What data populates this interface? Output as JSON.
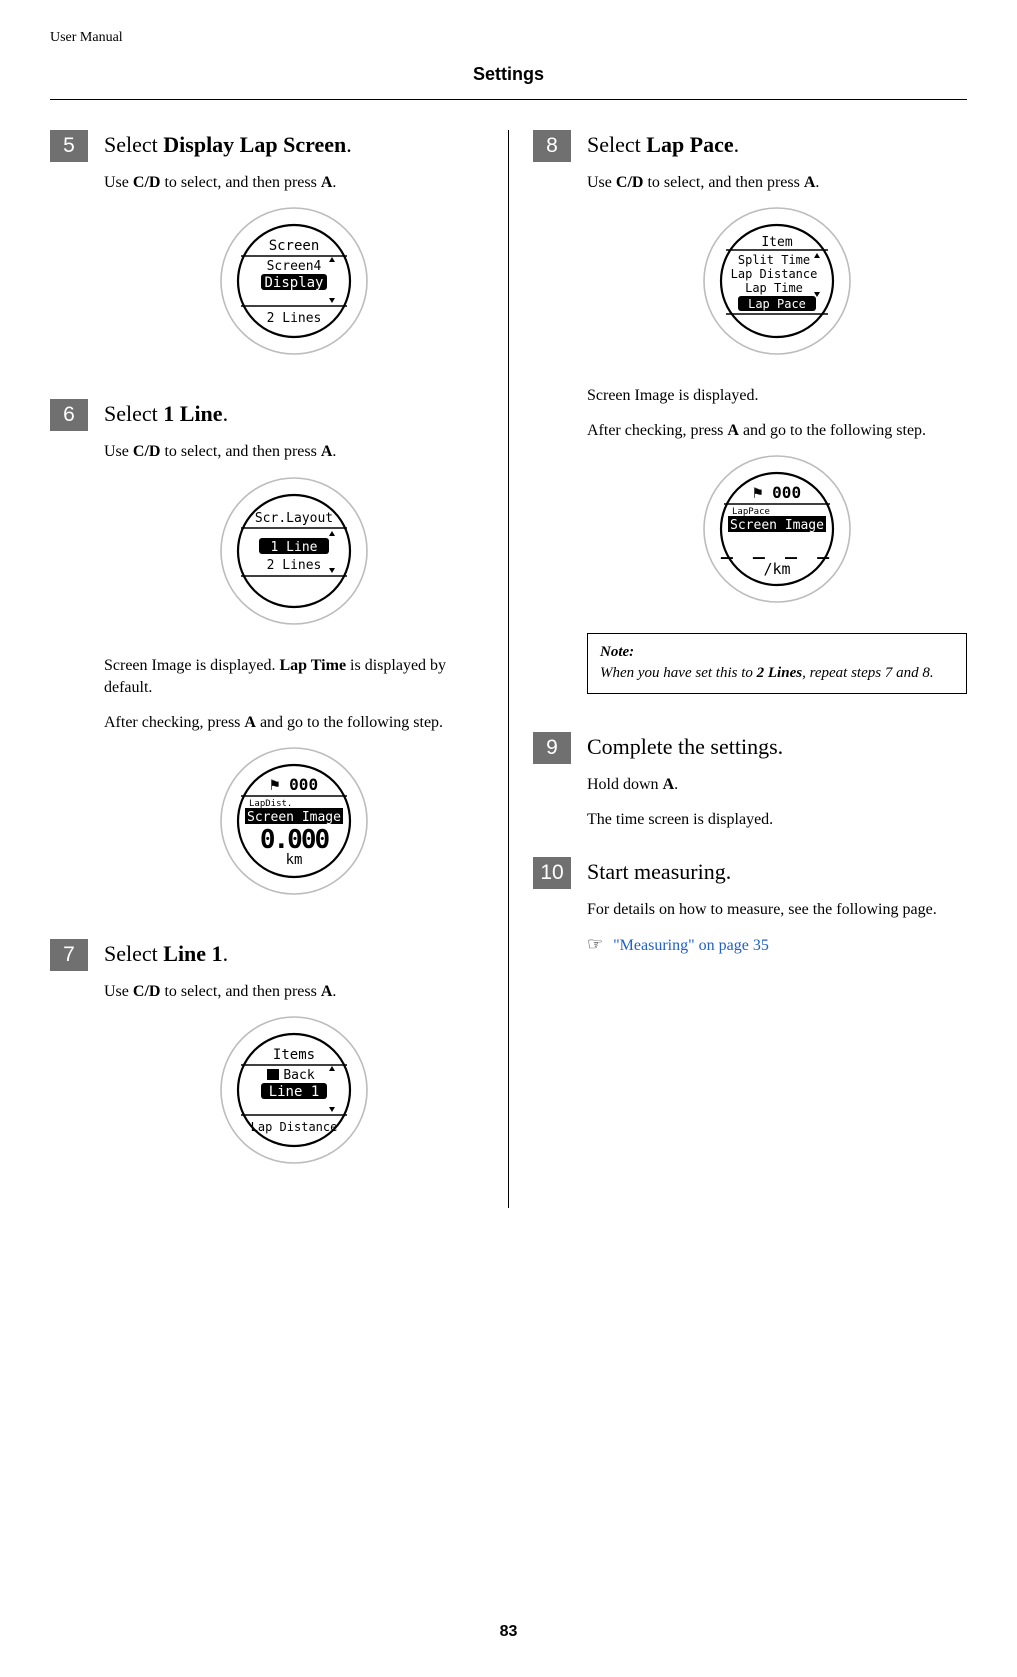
{
  "header": {
    "label": "User Manual"
  },
  "title": "Settings",
  "page_number": "83",
  "steps": {
    "s5": {
      "num": "5",
      "title_pre": "Select ",
      "title_bold": "Display Lap Screen",
      "title_post": ".",
      "use_pre": "Use ",
      "use_cd": "C/D",
      "use_mid": " to select, and then press ",
      "use_a": "A",
      "use_post": ".",
      "watch": {
        "top": "Screen",
        "l1": "Screen4",
        "hl": "Display",
        "bottom": "2 Lines"
      }
    },
    "s6": {
      "num": "6",
      "title_pre": "Select ",
      "title_bold": "1 Line",
      "title_post": ".",
      "use_pre": "Use ",
      "use_cd": "C/D",
      "use_mid": " to select, and then press ",
      "use_a": "A",
      "use_post": ".",
      "watch": {
        "top": "Scr.Layout",
        "hl": "1 Line",
        "l2": "2 Lines"
      },
      "after1_pre": "Screen Image is displayed. ",
      "after1_bold": "Lap Time",
      "after1_post": " is displayed by default.",
      "after2_pre": "After checking, press ",
      "after2_a": "A",
      "after2_post": " and go to the following step.",
      "watch2": {
        "flag": "⚑ 000",
        "small": "LapDist.",
        "hl": "Screen Image",
        "big": "0.000",
        "unit": "km"
      }
    },
    "s7": {
      "num": "7",
      "title_pre": "Select ",
      "title_bold": "Line 1",
      "title_post": ".",
      "use_pre": "Use ",
      "use_cd": "C/D",
      "use_mid": " to select, and then press ",
      "use_a": "A",
      "use_post": ".",
      "watch": {
        "top": "Items",
        "l1": "Back",
        "hl": "Line 1",
        "bottom": "Lap Distance"
      }
    },
    "s8": {
      "num": "8",
      "title_pre": "Select ",
      "title_bold": "Lap Pace",
      "title_post": ".",
      "use_pre": "Use ",
      "use_cd": "C/D",
      "use_mid": " to select, and then press ",
      "use_a": "A",
      "use_post": ".",
      "watch": {
        "top": "Item",
        "l1": "Split Time",
        "l2": "Lap Distance",
        "l3": "Lap Time",
        "hl": "Lap Pace"
      },
      "after1": "Screen Image is displayed.",
      "after2_pre": "After checking, press ",
      "after2_a": "A",
      "after2_post": " and go to the following step.",
      "watch2": {
        "flag": "⚑ 000",
        "small": "LapPace",
        "hl": "Screen Image",
        "dashes": "_ _ _ _",
        "unit": "/km"
      },
      "note_title": "Note:",
      "note_pre": "When you have set this to ",
      "note_bold": "2 Lines",
      "note_post": ", repeat steps 7 and 8."
    },
    "s9": {
      "num": "9",
      "title": "Complete the settings.",
      "line1_pre": "Hold down ",
      "line1_a": "A",
      "line1_post": ".",
      "line2": "The time screen is displayed."
    },
    "s10": {
      "num": "10",
      "title": "Start measuring.",
      "line1": "For details on how to measure, see the following page.",
      "ref_icon": "☞",
      "ref_text": "\"Measuring\" on page 35"
    }
  }
}
